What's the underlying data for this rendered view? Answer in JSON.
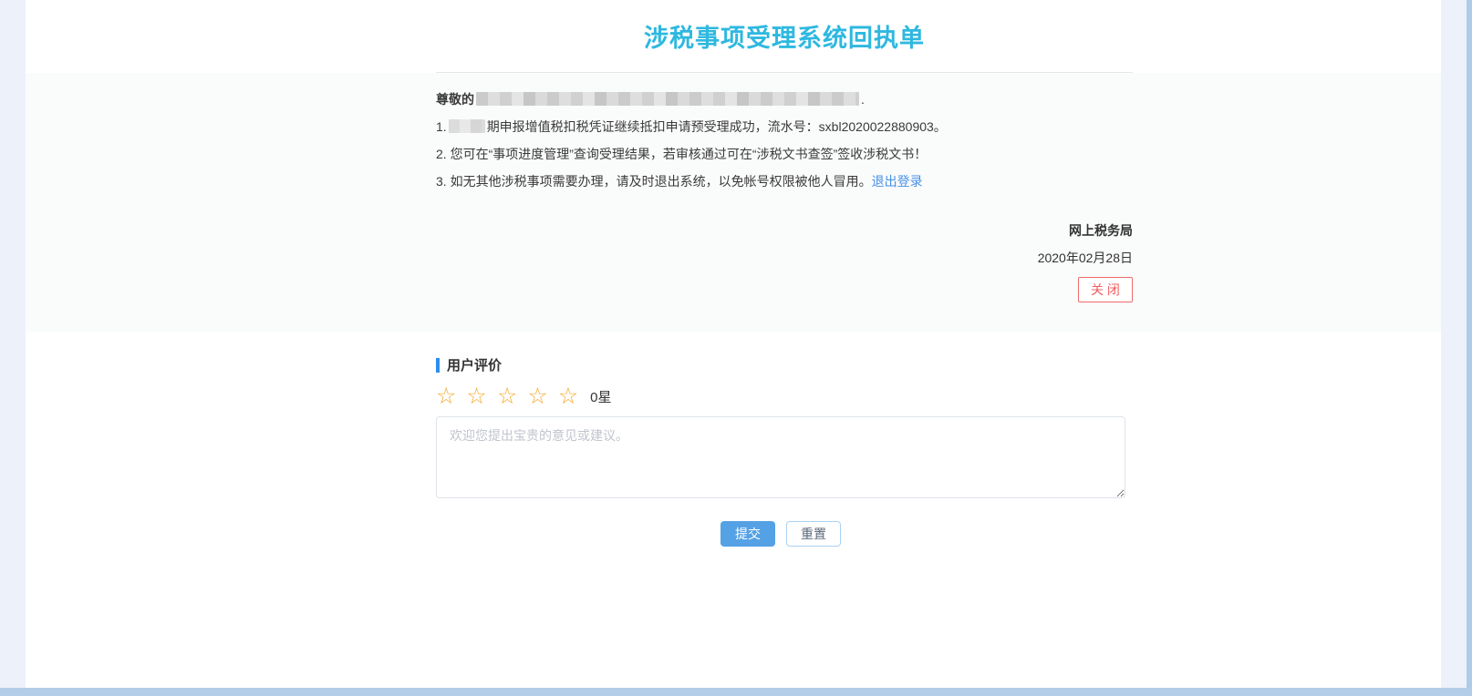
{
  "page": {
    "title": "涉税事项受理系统回执单"
  },
  "receipt": {
    "greeting_prefix": "尊敬的",
    "greeting_suffix": ".",
    "items": [
      {
        "num": "1.",
        "text": "期申报增值税扣税凭证继续抵扣申请预受理成功，流水号：sxbl2020022880903。"
      },
      {
        "num": "2.",
        "text": "您可在“事项进度管理”查询受理结果，若审核通过可在“涉税文书查签”签收涉税文书！"
      },
      {
        "num": "3.",
        "text": "如无其他涉税事项需要办理，请及时退出系统，以免帐号权限被他人冒用。",
        "link_label": "退出登录"
      }
    ],
    "signature": "网上税务局",
    "date": "2020年02月28日",
    "close_button": "关 闭"
  },
  "feedback": {
    "section_title": "用户评价",
    "star_char": "☆",
    "star_count": 5,
    "rating_label": "0星",
    "textarea_placeholder": "欢迎您提出宝贵的意见或建议。",
    "submit_button": "提交",
    "reset_button": "重置"
  },
  "colors": {
    "title_cyan": "#2eb8e0",
    "link_blue": "#4690e8",
    "close_red": "#f05c5c",
    "star_orange": "#f7a92d",
    "section_bar_blue": "#2d8cf0",
    "submit_blue": "#54a1e5",
    "side_strip": "#edf1f9",
    "scrollbar_blue": "#b3cde9",
    "receipt_bg": "#fafbfb"
  }
}
